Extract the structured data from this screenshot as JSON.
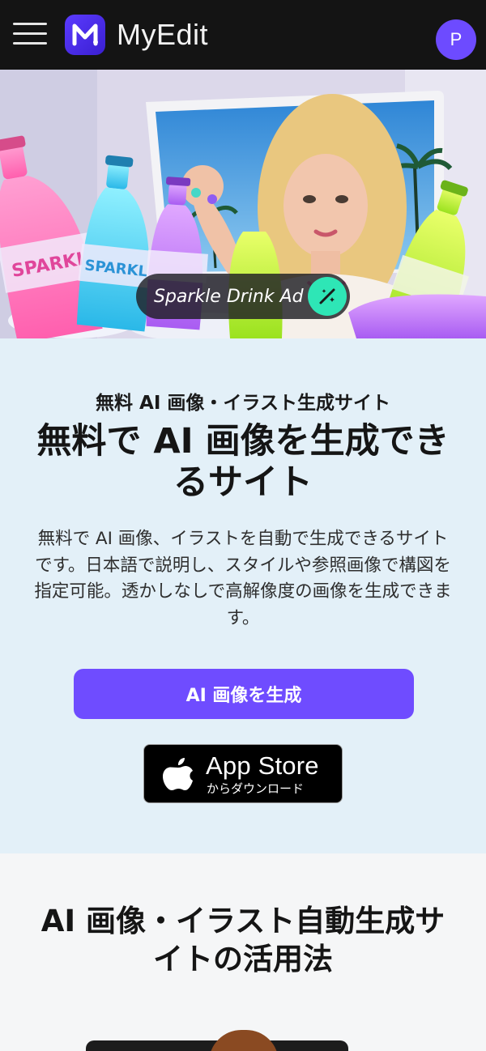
{
  "header": {
    "menu_icon": "hamburger-icon",
    "logo_icon": "myedit-logo-icon",
    "logo_text": "MyEdit",
    "avatar_initial": "P"
  },
  "hero": {
    "chip_label": "Sparkle Drink Ad",
    "chip_icon": "magic-wand-icon",
    "bottle_text": "SPARKLE"
  },
  "main": {
    "eyebrow": "無料 AI 画像・イラスト生成サイト",
    "headline": "無料で AI 画像を生成できるサイト",
    "description": "無料で AI 画像、イラストを自動で生成できるサイトです。日本語で説明し、スタイルや参照画像で構図を指定可能。透かしなしで高解像度の画像を生成できます。",
    "cta_label": "AI 画像を生成",
    "app_store_title": "App Store",
    "app_store_sub": "からダウンロード",
    "app_store_icon": "apple-icon"
  },
  "section2": {
    "title": "AI 画像・イラスト自動生成サイトの活用法"
  },
  "colors": {
    "accent": "#6f4cff",
    "topbar": "#141414",
    "main_bg": "#e3f0f8",
    "chip_icon_bg": "#2ee6b6"
  }
}
